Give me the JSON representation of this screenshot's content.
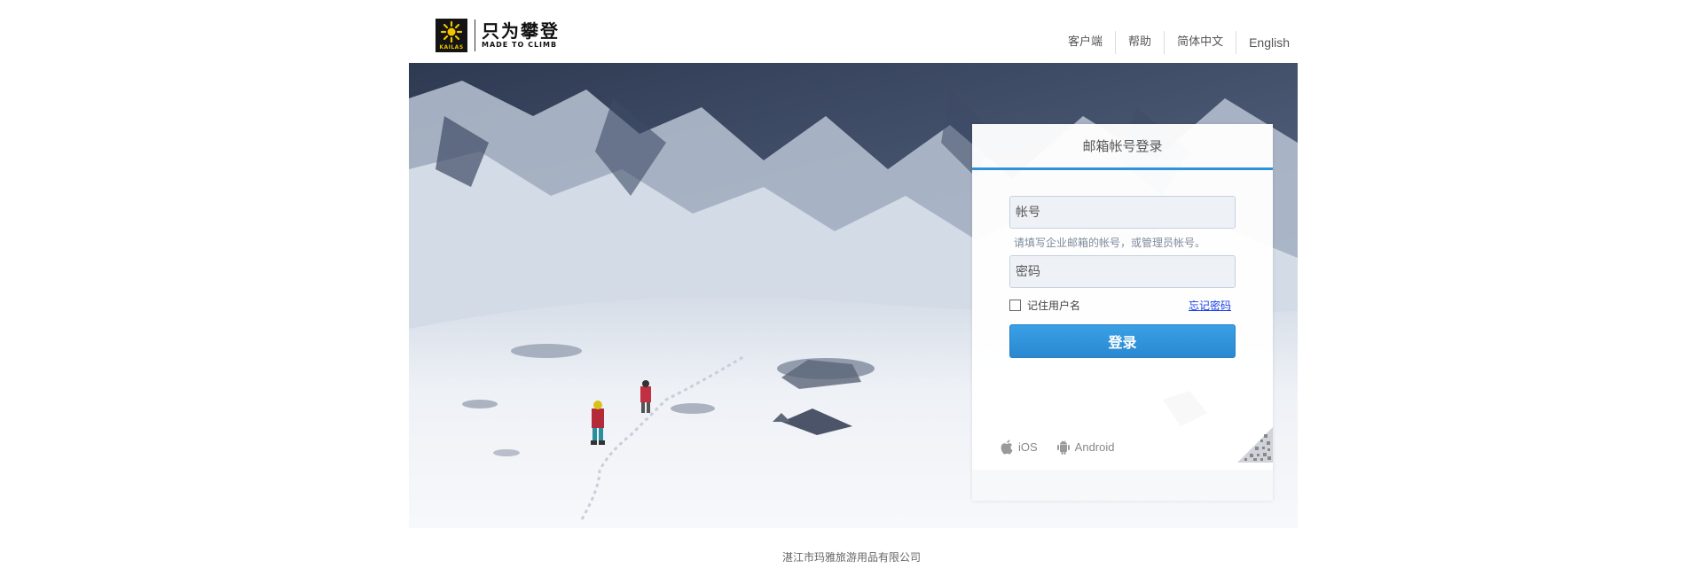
{
  "header": {
    "logo": {
      "brand_cn": "只为攀登",
      "brand_en": "MADE TO CLIMB",
      "badge_text": "KAILAS"
    },
    "nav": [
      {
        "label": "客户端"
      },
      {
        "label": "帮助"
      },
      {
        "label": "简体中文"
      },
      {
        "label": "English"
      }
    ]
  },
  "login": {
    "tab_title": "邮箱帐号登录",
    "account_placeholder": "帐号",
    "account_hint": "请填写企业邮箱的帐号，或管理员帐号。",
    "password_placeholder": "密码",
    "remember_label": "记住用户名",
    "forgot_label": "忘记密码",
    "submit_label": "登录",
    "apps": [
      {
        "label": "iOS",
        "icon": "apple-icon"
      },
      {
        "label": "Android",
        "icon": "android-icon"
      }
    ]
  },
  "footer": {
    "company": "湛江市玛雅旅游用品有限公司"
  },
  "colors": {
    "accent": "#2f93db",
    "link": "#1a3fe6",
    "button": "#3598dc"
  }
}
